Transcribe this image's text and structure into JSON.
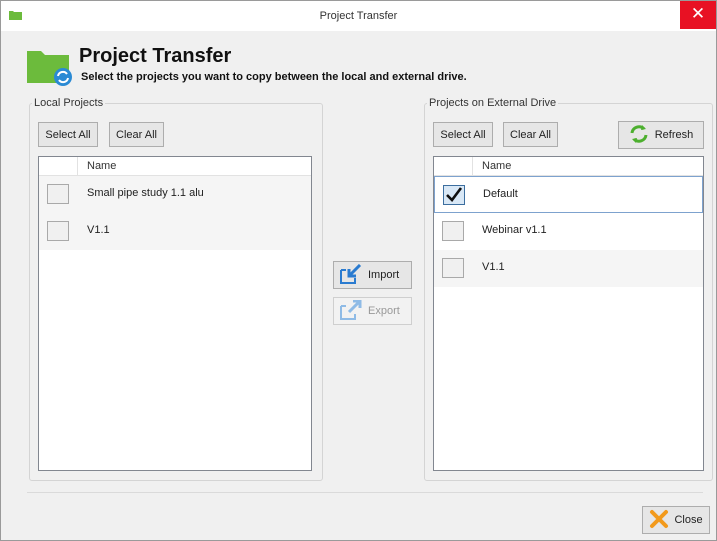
{
  "window": {
    "title": "Project Transfer",
    "close_glyph": "✕"
  },
  "header": {
    "title": "Project Transfer",
    "subtitle": "Select the projects you want to copy between the local and external drive."
  },
  "local": {
    "group_label": "Local Projects",
    "select_all": "Select All",
    "clear_all": "Clear All",
    "column_name": "Name",
    "rows": [
      {
        "name": "Small pipe study 1.1 alu",
        "checked": false
      },
      {
        "name": "V1.1",
        "checked": false
      }
    ]
  },
  "middle": {
    "import_label": "Import",
    "export_label": "Export",
    "export_enabled": false
  },
  "external": {
    "group_label": "Projects on External Drive",
    "select_all": "Select All",
    "clear_all": "Clear All",
    "refresh": "Refresh",
    "column_name": "Name",
    "rows": [
      {
        "name": "Default",
        "checked": true
      },
      {
        "name": "Webinar v1.1",
        "checked": false
      },
      {
        "name": "V1.1",
        "checked": false
      }
    ]
  },
  "footer": {
    "close_label": "Close"
  },
  "colors": {
    "accent_green": "#6cbb3c",
    "folder_blue": "#2a8ad4",
    "close_red": "#e81123",
    "close_orange": "#f29a1c",
    "import_blue": "#2a7bd0"
  },
  "icons": {
    "app": "folder-icon",
    "header": "folder-sync-icon",
    "import": "import-icon",
    "export": "export-icon",
    "refresh": "refresh-icon",
    "close": "close-x-icon",
    "check": "checkmark-icon"
  }
}
